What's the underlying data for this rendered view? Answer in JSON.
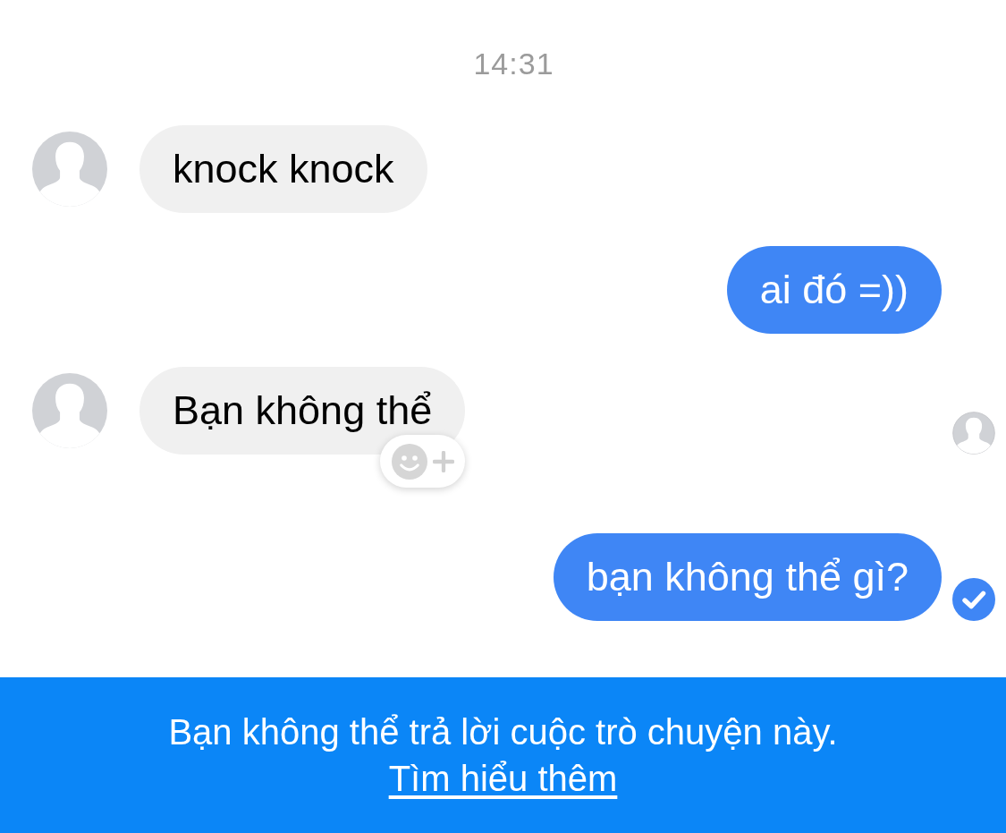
{
  "timestamp": "14:31",
  "messages": [
    {
      "kind": "incoming",
      "text": "knock knock",
      "reaction_button": false,
      "seen": false,
      "delivered": false
    },
    {
      "kind": "outgoing",
      "text": "ai đó =))",
      "reaction_button": false,
      "seen": false,
      "delivered": false
    },
    {
      "kind": "incoming",
      "text": "Bạn không thể",
      "reaction_button": true,
      "seen": true,
      "delivered": false
    },
    {
      "kind": "outgoing",
      "text": "bạn không thể gì?",
      "reaction_button": false,
      "seen": false,
      "delivered": true
    }
  ],
  "notice": {
    "text": "Bạn không thể trả lời cuộc trò chuyện này.",
    "link": "Tìm hiểu thêm"
  }
}
